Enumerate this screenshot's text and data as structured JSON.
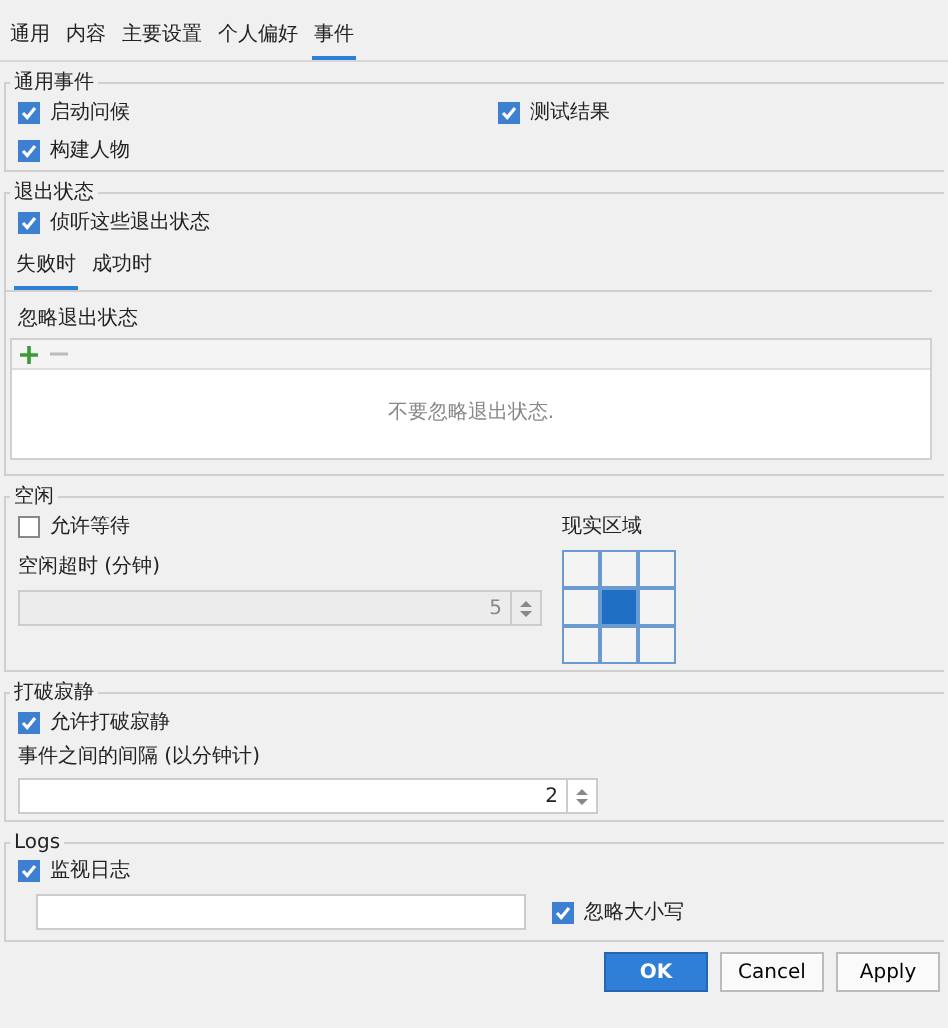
{
  "tabs": [
    {
      "label": "通用",
      "selected": false
    },
    {
      "label": "内容",
      "selected": false
    },
    {
      "label": "主要设置",
      "selected": false
    },
    {
      "label": "个人偏好",
      "selected": false
    },
    {
      "label": "事件",
      "selected": true
    }
  ],
  "general_events": {
    "title": "通用事件",
    "options": [
      {
        "label": "启动问候",
        "checked": true
      },
      {
        "label": "测试结果",
        "checked": true
      },
      {
        "label": "构建人物",
        "checked": true
      }
    ]
  },
  "exit_status": {
    "title": "退出状态",
    "listen": {
      "label": "侦听这些退出状态",
      "checked": true
    },
    "tabs": [
      {
        "label": "失败时",
        "selected": true
      },
      {
        "label": "成功时",
        "selected": false
      }
    ],
    "ignore_label": "忽略退出状态",
    "empty_message": "不要忽略退出状态."
  },
  "idle": {
    "title": "空闲",
    "allow_wait": {
      "label": "允许等待",
      "checked": false
    },
    "timeout_label": "空闲超时 (分钟)",
    "timeout": {
      "value": "5",
      "disabled": true
    },
    "region_label": "现实区域",
    "region_cells": [
      {
        "selected": false
      },
      {
        "selected": false
      },
      {
        "selected": false
      },
      {
        "selected": false
      },
      {
        "selected": true
      },
      {
        "selected": false
      },
      {
        "selected": false
      },
      {
        "selected": false
      },
      {
        "selected": false
      }
    ]
  },
  "break_silence": {
    "title": "打破寂静",
    "allow": {
      "label": "允许打破寂静",
      "checked": true
    },
    "interval_label": "事件之间的间隔 (以分钟计)",
    "interval": {
      "value": "2",
      "disabled": false
    }
  },
  "logs": {
    "title": "Logs",
    "monitor": {
      "label": "监视日志",
      "checked": true
    },
    "ignore_case": {
      "label": "忽略大小写",
      "checked": true
    }
  },
  "buttons": [
    {
      "label": "OK",
      "kind": "primary"
    },
    {
      "label": "Cancel",
      "kind": "normal"
    },
    {
      "label": "Apply",
      "kind": "normal"
    }
  ]
}
